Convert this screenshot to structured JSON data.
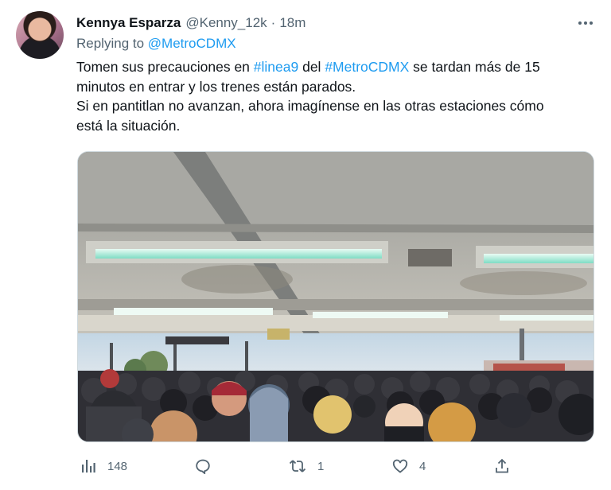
{
  "tweet": {
    "author_name": "Kennya Esparza",
    "author_handle": "@Kenny_12k",
    "separator": "·",
    "time": "18m",
    "more_icon": "more-icon",
    "replying_prefix": "Replying to",
    "replying_to": "@MetroCDMX",
    "text_line1_a": "Tomen sus precauciones en ",
    "text_line1_tag1": "#linea9",
    "text_line1_b": " del ",
    "text_line1_tag2": "#MetroCDMX",
    "text_line1_c": " se tardan más de 15",
    "text_line2": "minutos en entrar y los trenes están parados.",
    "text_line3": "Si en pantitlan no avanzan, ahora imagínense en las otras estaciones cómo",
    "text_line4": "está la situación.",
    "media_icon": "photo-crowded-metro-station"
  },
  "actions": {
    "views_count": "148",
    "reply_count": "",
    "retweet_count": "1",
    "like_count": "4",
    "icons": [
      "analytics-icon",
      "reply-icon",
      "retweet-icon",
      "like-icon",
      "share-icon"
    ]
  },
  "colors": {
    "accent": "#1d9bf0",
    "text": "#0f1419",
    "secondary": "#536471",
    "border": "#cfd9de"
  }
}
